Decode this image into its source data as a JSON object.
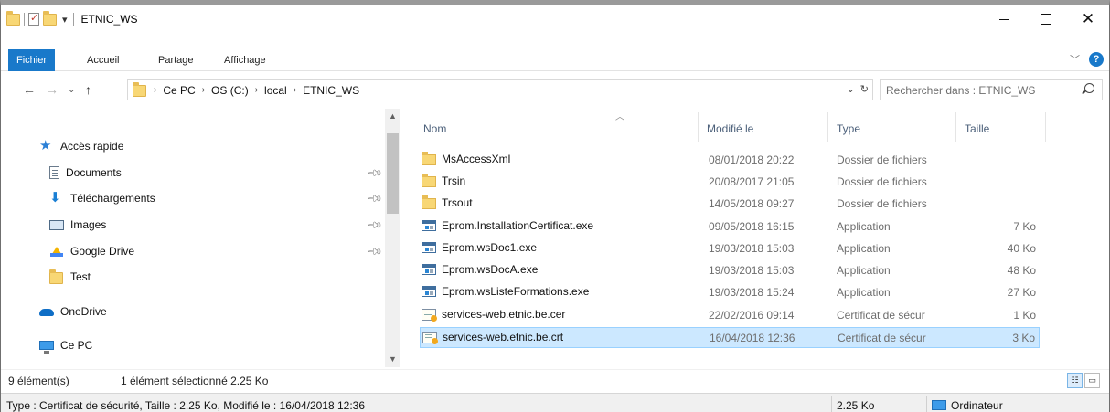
{
  "window": {
    "title": "ETNIC_WS"
  },
  "ribbon": {
    "tabs": [
      "Fichier",
      "Accueil",
      "Partage",
      "Affichage"
    ],
    "help_label": "?"
  },
  "address": {
    "crumbs": [
      "Ce PC",
      "OS (C:)",
      "local",
      "ETNIC_WS"
    ],
    "search_placeholder": "Rechercher dans : ETNIC_WS"
  },
  "navpane": {
    "quick_access": "Accès rapide",
    "items": [
      {
        "label": "Documents",
        "icon": "document-icon",
        "pinned": true
      },
      {
        "label": "Téléchargements",
        "icon": "download-icon",
        "pinned": true
      },
      {
        "label": "Images",
        "icon": "images-icon",
        "pinned": true
      },
      {
        "label": "Google Drive",
        "icon": "google-drive-icon",
        "pinned": true
      },
      {
        "label": "Test",
        "icon": "folder-icon",
        "pinned": false
      }
    ],
    "onedrive": "OneDrive",
    "this_pc": "Ce PC"
  },
  "filelist": {
    "columns": [
      "Nom",
      "Modifié le",
      "Type",
      "Taille"
    ],
    "rows": [
      {
        "name": "MsAccessXml",
        "date": "08/01/2018 20:22",
        "type": "Dossier de fichiers",
        "size": "",
        "icon": "folder"
      },
      {
        "name": "Trsin",
        "date": "20/08/2017 21:05",
        "type": "Dossier de fichiers",
        "size": "",
        "icon": "folder"
      },
      {
        "name": "Trsout",
        "date": "14/05/2018 09:27",
        "type": "Dossier de fichiers",
        "size": "",
        "icon": "folder"
      },
      {
        "name": "Eprom.InstallationCertificat.exe",
        "date": "09/05/2018 16:15",
        "type": "Application",
        "size": "7 Ko",
        "icon": "app"
      },
      {
        "name": "Eprom.wsDoc1.exe",
        "date": "19/03/2018 15:03",
        "type": "Application",
        "size": "40 Ko",
        "icon": "app"
      },
      {
        "name": "Eprom.wsDocA.exe",
        "date": "19/03/2018 15:03",
        "type": "Application",
        "size": "48 Ko",
        "icon": "app"
      },
      {
        "name": "Eprom.wsListeFormations.exe",
        "date": "19/03/2018 15:24",
        "type": "Application",
        "size": "27 Ko",
        "icon": "app"
      },
      {
        "name": "services-web.etnic.be.cer",
        "date": "22/02/2016 09:14",
        "type": "Certificat de sécur",
        "size": "1 Ko",
        "icon": "cert"
      },
      {
        "name": "services-web.etnic.be.crt",
        "date": "16/04/2018 12:36",
        "type": "Certificat de sécur",
        "size": "3 Ko",
        "icon": "cert",
        "selected": true
      }
    ]
  },
  "status": {
    "count": "9 élément(s)",
    "selection": "1 élément sélectionné  2.25 Ko",
    "details": "Type : Certificat de sécurité, Taille : 2.25 Ko, Modifié le : 16/04/2018 12:36",
    "size": "2.25 Ko",
    "location": "Ordinateur"
  },
  "colors": {
    "accent": "#1979ca",
    "selection_bg": "#cce8ff",
    "selection_border": "#99d1ff"
  }
}
